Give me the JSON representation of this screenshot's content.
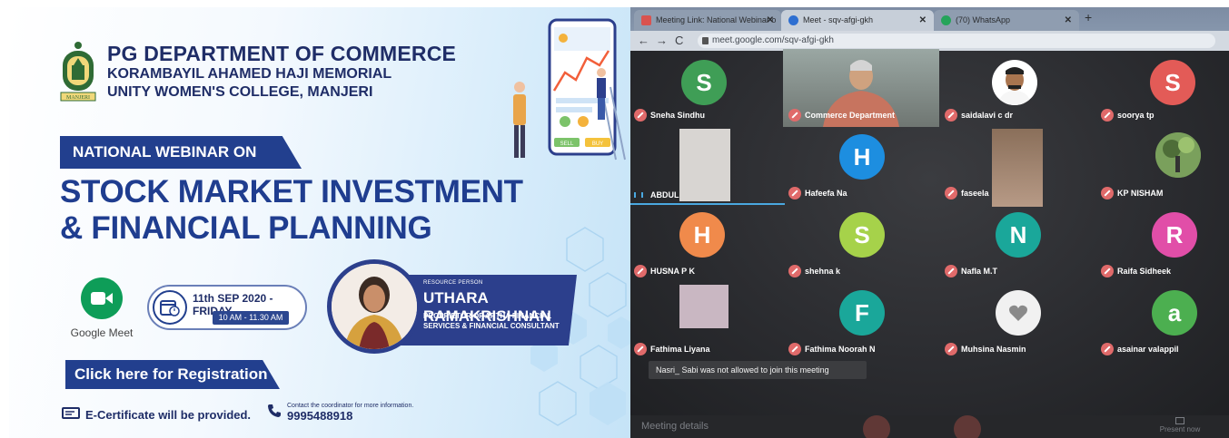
{
  "poster": {
    "dept_line1": "PG DEPARTMENT OF COMMERCE",
    "dept_line2": "KORAMBAYIL AHAMED HAJI MEMORIAL",
    "dept_line3": "UNITY WOMEN'S COLLEGE, MANJERI",
    "logo_caption": "MANJERI",
    "national_banner": "NATIONAL WEBINAR ON",
    "headline_line1": "STOCK MARKET INVESTMENT",
    "headline_line2": "& FINANCIAL PLANNING",
    "platform_label": "Google Meet",
    "date": "11th SEP 2020 - FRIDAY",
    "time": "10 AM - 11.30 AM",
    "resource_role": "RESOURCE PERSON",
    "resource_name": "UTHARA RAMAKRISHNAN",
    "resource_desc_line1": "PROPRIETOR OF ARTHA FINANCIAL",
    "resource_desc_line2": "SERVICES & FINANCIAL CONSULTANT",
    "register_label": "Click here for Registration",
    "ecert_label": "E-Certificate will be provided.",
    "contact_note": "Contact the coordinator for more information.",
    "contact_phone": "9995488918",
    "illustration_buttons": [
      "SELL",
      "BUY"
    ]
  },
  "browser": {
    "tabs": [
      {
        "label": "Meeting Link: National Webinar o",
        "icon": "gmail-icon",
        "active": false
      },
      {
        "label": "Meet - sqv-afgi-gkh",
        "icon": "meet-icon",
        "active": true
      },
      {
        "label": "(70) WhatsApp",
        "icon": "whatsapp-icon",
        "active": false
      }
    ],
    "close_glyph": "✕",
    "new_tab_glyph": "+",
    "url": "meet.google.com/sqv-afgi-gkh"
  },
  "meet": {
    "participants": [
      {
        "name": "Sneha Sindhu",
        "initial": "S",
        "color": "#3f9e56"
      },
      {
        "name": "Commerce Department",
        "initial": "",
        "color": "#5a5f66"
      },
      {
        "name": "saidalavi c dr",
        "initial": "",
        "color": "#ffffff"
      },
      {
        "name": "soorya tp",
        "initial": "S",
        "color": "#e35b57"
      },
      {
        "name": "ABDUL",
        "initial": "",
        "color": "#d8d8d8"
      },
      {
        "name": "Hafeefa Na",
        "initial": "H",
        "color": "#1d8ee0"
      },
      {
        "name": "faseela",
        "initial": "",
        "color": "#8a6f5a"
      },
      {
        "name": "KP NISHAM",
        "initial": "",
        "color": "#5b7f46"
      },
      {
        "name": "HUSNA P K",
        "initial": "H",
        "color": "#f08a4b"
      },
      {
        "name": "shehna k",
        "initial": "S",
        "color": "#a6d24a"
      },
      {
        "name": "Nafla M.T",
        "initial": "N",
        "color": "#1aa79a"
      },
      {
        "name": "Raifa Sidheek",
        "initial": "R",
        "color": "#e14ea8"
      },
      {
        "name": "Fathima Liyana",
        "initial": "",
        "color": "#c9b7c2"
      },
      {
        "name": "Fathima Noorah N",
        "initial": "F",
        "color": "#1aa79a"
      },
      {
        "name": "Muhsina Nasmin",
        "initial": "",
        "color": "#f1f1f1"
      },
      {
        "name": "asainar valappil",
        "initial": "a",
        "color": "#4caf50"
      }
    ],
    "toast": "Nasri_ Sabi was not allowed to join this meeting",
    "meeting_details": "Meeting details",
    "present_now": "Present now"
  }
}
